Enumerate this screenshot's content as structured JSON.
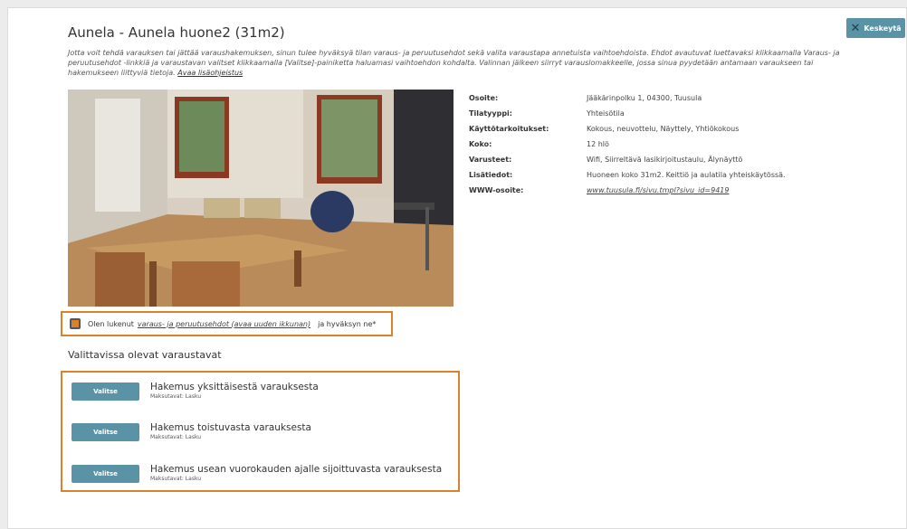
{
  "header": {
    "title": "Aunela - Aunela huone2 (31m2)",
    "cancel_label": "Keskeytä"
  },
  "intro": {
    "text": "Jotta voit tehdä varauksen tai jättää varaushakemuksen, sinun tulee hyväksyä tilan varaus- ja peruutusehdot sekä valita varaustapa annetuista vaihtoehdoista. Ehdot avautuvat luettavaksi klikkaamalla Varaus- ja peruutusehdot -linkkiä ja varaustavan valitset klikkaamalla [Valitse]-painiketta haluamasi vaihtoehdon kohdalta. Valinnan jälkeen siirryt varauslomakkeelle, jossa sinua pyydetään antamaan varaukseen tai hakemukseen liittyviä tietoja.",
    "link": "Avaa lisäohjeistus"
  },
  "details": [
    {
      "label": "Osoite:",
      "value": "Jääkärinpolku 1, 04300, Tuusula"
    },
    {
      "label": "Tilatyyppi:",
      "value": "Yhteisötila"
    },
    {
      "label": "Käyttötarkoitukset:",
      "value": "Kokous, neuvottelu, Näyttely, Yhtiökokous"
    },
    {
      "label": "Koko:",
      "value": "12 hlö"
    },
    {
      "label": "Varusteet:",
      "value": "Wifi, Siirreltävä lasikirjoitustaulu, Älynäyttö"
    },
    {
      "label": "Lisätiedot:",
      "value": "Huoneen koko 31m2. Keittiö ja aulatila yhteiskäytössä."
    },
    {
      "label": "WWW-osoite:",
      "value": "www.tuusula.fi/sivu.tmpl?sivu_id=9419"
    }
  ],
  "accept": {
    "prefix": "Olen lukenut",
    "link": "varaus- ja peruutusehdot (avaa uuden ikkunan)",
    "suffix": "ja hyväksyn ne*",
    "checked": true
  },
  "options_title": "Valittavissa olevat varaustavat",
  "options": [
    {
      "button": "Valitse",
      "name": "Hakemus yksittäisestä varauksesta",
      "payment": "Maksutavat: Lasku"
    },
    {
      "button": "Valitse",
      "name": "Hakemus toistuvasta varauksesta",
      "payment": "Maksutavat: Lasku"
    },
    {
      "button": "Valitse",
      "name": "Hakemus usean vuorokauden ajalle sijoittuvasta varauksesta",
      "payment": "Maksutavat: Lasku"
    }
  ],
  "colors": {
    "accent": "#d9822b",
    "button": "#5a93a6"
  }
}
